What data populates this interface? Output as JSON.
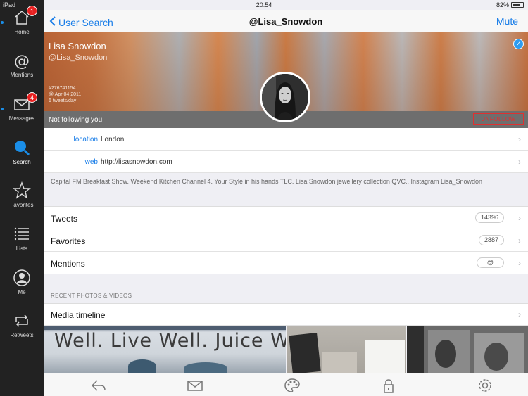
{
  "status_bar": {
    "device": "iPad",
    "time": "20:54",
    "battery": "82%",
    "battery_level": 0.82
  },
  "sidebar": {
    "items": [
      {
        "label": "Home",
        "badge": "1"
      },
      {
        "label": "Mentions"
      },
      {
        "label": "Messages",
        "badge": "4"
      },
      {
        "label": "Search"
      },
      {
        "label": "Favorites"
      },
      {
        "label": "Lists"
      },
      {
        "label": "Me"
      },
      {
        "label": "Retweets"
      }
    ]
  },
  "navbar": {
    "back_label": "User Search",
    "title": "@Lisa_Snowdon",
    "right_label": "Mute"
  },
  "profile": {
    "name": "Lisa Snowdon",
    "handle": "@Lisa_Snowdon",
    "id": "#276741154",
    "joined": "@ Apr 04 2011",
    "rate": "6 tweets/day",
    "follow_status": "Not following you",
    "unfollow_label": "UNFOLLOW"
  },
  "info": {
    "location_key": "location",
    "location_value": "London",
    "web_key": "web",
    "web_value": "http://lisasnowdon.com"
  },
  "bio": "Capital FM Breakfast Show. Weekend Kitchen Channel 4. Your Style in his hands TLC. Lisa Snowdon jewellery collection QVC.. Instagram Lisa_Snowdon",
  "stats": [
    {
      "label": "Tweets",
      "value": "14396"
    },
    {
      "label": "Favorites",
      "value": "2887"
    },
    {
      "label": "Mentions",
      "value": "@"
    }
  ],
  "recent": {
    "header": "RECENT PHOTOS & VIDEOS",
    "media_label": "Media timeline",
    "photo_sign": "Well. Live Well. Juice W"
  },
  "colors": {
    "accent": "#1a7ee8",
    "badge": "#e82020",
    "unfollow": "#e03030",
    "sidebar": "#222222"
  }
}
